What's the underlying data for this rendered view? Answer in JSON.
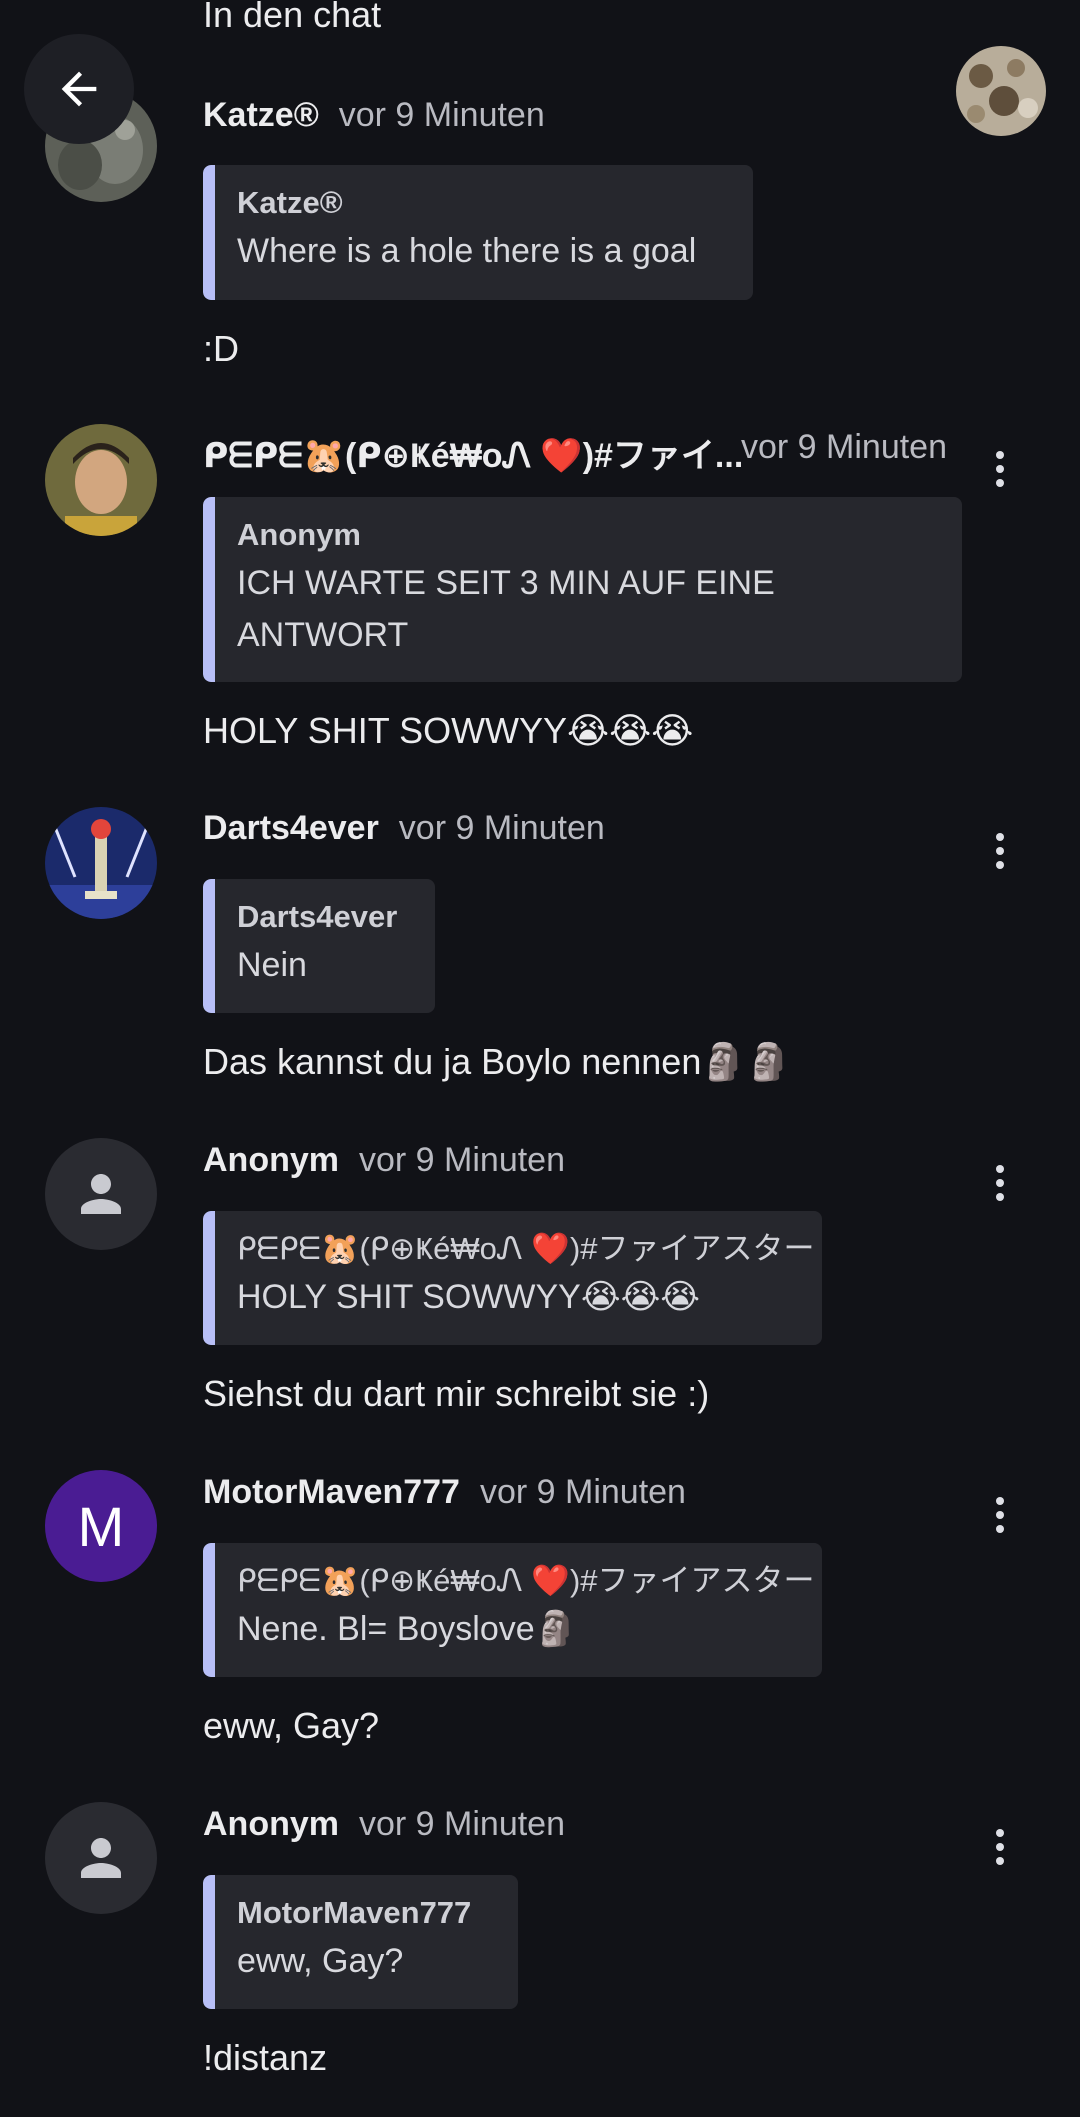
{
  "header": {
    "top_text": "In den chat",
    "back_icon": "arrow-left-icon"
  },
  "messages": [
    {
      "id": "m1",
      "author": "Katze®",
      "time": "vor 9 Minuten",
      "quote": {
        "author": "Katze®",
        "text": "Where is a hole there is a goal"
      },
      "text": ":D"
    },
    {
      "id": "m2",
      "author": "ᑭᗴᑭᗴ🐹(ᑭ⊕Ҝé₩oᏁ ❤️)#ファイ...",
      "time": "vor 9 Minuten",
      "quote": {
        "author": "Anonym",
        "text": "ICH WARTE SEIT 3 MIN AUF EINE ANTWORT"
      },
      "text": "HOLY SHIT SOWWYY😭😭😭"
    },
    {
      "id": "m3",
      "author": "Darts4ever",
      "time": "vor 9 Minuten",
      "quote": {
        "author": "Darts4ever",
        "text": "Nein"
      },
      "text": "Das kannst du ja Boylo nennen🗿🗿"
    },
    {
      "id": "m4",
      "author": "Anonym",
      "time": "vor 9 Minuten",
      "quote": {
        "author": "ᑭᗴᑭᗴ🐹(ᑭ⊕Ҝé₩oᏁ ❤️)#ファイアスター",
        "text": "HOLY SHIT SOWWYY😭😭😭"
      },
      "text": "Siehst du dart mir schreibt sie :)"
    },
    {
      "id": "m5",
      "author": "MotorMaven777",
      "avatar_letter": "M",
      "time": "vor 9 Minuten",
      "quote": {
        "author": "ᑭᗴᑭᗴ🐹(ᑭ⊕Ҝé₩oᏁ ❤️)#ファイアスター",
        "text": "Nene. Bl= Boyslove🗿"
      },
      "text": "eww, Gay?"
    },
    {
      "id": "m6",
      "author": "Anonym",
      "time": "vor 9 Minuten",
      "quote": {
        "author": "MotorMaven777",
        "text": "eww, Gay?"
      },
      "text": "!distanz"
    }
  ],
  "colors": {
    "background": "#111217",
    "quote_bg": "#26272d",
    "quote_bar": "#b8bff7",
    "letter_avatar": "#4a1c93"
  }
}
